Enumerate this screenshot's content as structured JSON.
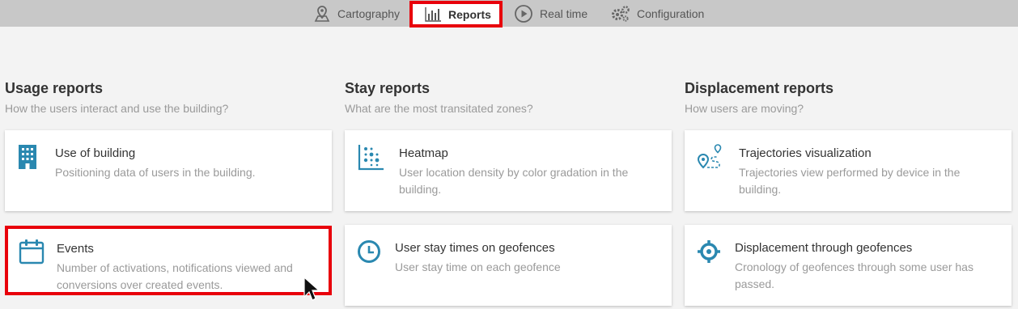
{
  "nav": {
    "items": [
      {
        "label": "Cartography",
        "icon": "map-pin-icon"
      },
      {
        "label": "Reports",
        "icon": "bar-chart-icon",
        "active": true
      },
      {
        "label": "Real time",
        "icon": "play-circle-icon"
      },
      {
        "label": "Configuration",
        "icon": "gears-icon"
      }
    ]
  },
  "sections": [
    {
      "title": "Usage reports",
      "subtitle": "How the users interact and use the building?",
      "cards": [
        {
          "title": "Use of building",
          "description": "Positioning data of users in the building.",
          "icon": "building-icon"
        },
        {
          "title": "Events",
          "description": "Number of activations, notifications viewed and conversions over created events.",
          "icon": "calendar-icon"
        }
      ]
    },
    {
      "title": "Stay reports",
      "subtitle": "What are the most transitated zones?",
      "cards": [
        {
          "title": "Heatmap",
          "description": "User location density by color gradation in the building.",
          "icon": "heatmap-icon"
        },
        {
          "title": "User stay times on geofences",
          "description": "User stay time on each geofence",
          "icon": "clock-icon"
        }
      ]
    },
    {
      "title": "Displacement reports",
      "subtitle": "How users are moving?",
      "cards": [
        {
          "title": "Trajectories visualization",
          "description": "Trajectories view performed by device in the building.",
          "icon": "trajectory-icon"
        },
        {
          "title": "Displacement through geofences",
          "description": "Cronology of geofences through some user has passed.",
          "icon": "crosshair-icon"
        }
      ]
    }
  ],
  "colors": {
    "accent": "#2a88b0",
    "highlight": "#e8000b",
    "nav_bg": "#c8c8c8"
  }
}
